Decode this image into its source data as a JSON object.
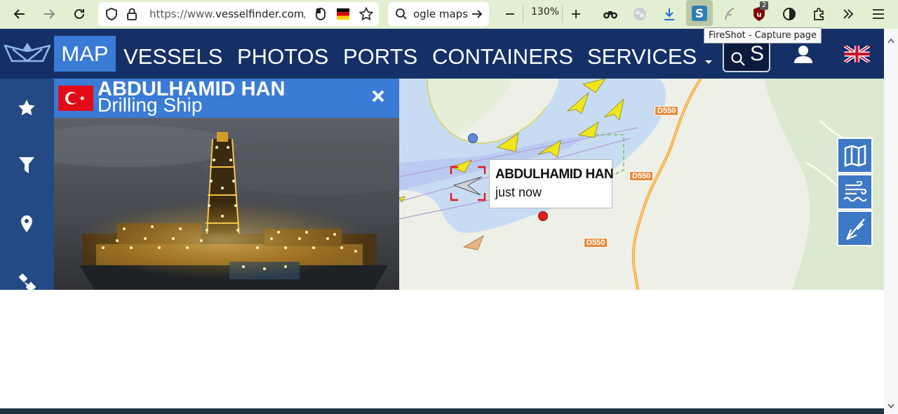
{
  "browser": {
    "url_prefix": "https://www.",
    "url_domain": "vesselfinder.com",
    "url_rest": "/?",
    "search_text": "ogle maps",
    "zoom": "130%",
    "tooltip": "FireShot - Capture page",
    "notification_count": "2"
  },
  "nav": {
    "items": [
      "MAP",
      "VESSELS",
      "PHOTOS",
      "PORTS",
      "CONTAINERS",
      "SERVICES"
    ],
    "search_letter": "S"
  },
  "vessel": {
    "name": "ABDULHAMID HAN",
    "type": "Drilling Ship"
  },
  "map": {
    "popup_name": "ABDULHAMID HAN",
    "popup_time": "just now",
    "road_labels": [
      "D550",
      "D550",
      "D550"
    ]
  },
  "colors": {
    "nav_bg": "#143067",
    "accent": "#3a7bd5",
    "browser_bar": "#e3efd2",
    "water": "#c7dcf2",
    "vessel_marker": "#f0e61c"
  },
  "icons": [
    "back-icon",
    "forward-icon",
    "reload-icon",
    "shield-icon",
    "lock-icon",
    "star-icon",
    "search-icon",
    "arrow-right-icon",
    "zoom-out-icon",
    "zoom-in-icon",
    "download-icon",
    "extensions-icon",
    "menu-icon",
    "user-icon",
    "filter-icon",
    "location-pin-icon",
    "satellite-icon",
    "map-layers-icon",
    "weather-icon",
    "ruler-icon",
    "close-icon"
  ]
}
